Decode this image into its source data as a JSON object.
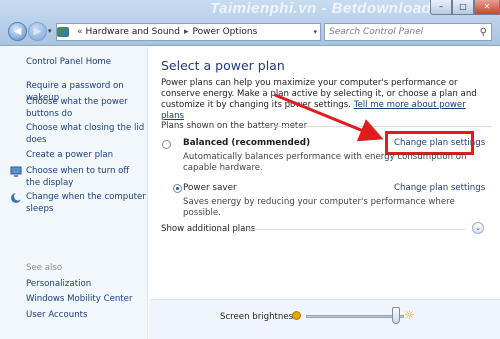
{
  "watermark": "Taimienphi.vn - Betdownload",
  "window": {
    "min": "–",
    "max": "□",
    "close": "✕"
  },
  "nav": {
    "back": "◀",
    "forward": "▶",
    "dropdown": "▾"
  },
  "address": {
    "chevron": "«",
    "crumbs": [
      "Hardware and Sound",
      "Power Options"
    ],
    "separator": "▸",
    "dropdown": "▾"
  },
  "refresh": "↻",
  "search": {
    "placeholder": "Search Control Panel",
    "icon": "⚲"
  },
  "sidebar": {
    "home": "Control Panel Home",
    "items": [
      {
        "label": "Require a password on wakeup"
      },
      {
        "label": "Choose what the power buttons do"
      },
      {
        "label": "Choose what closing the lid does"
      },
      {
        "label": "Create a power plan"
      },
      {
        "label": "Choose when to turn off the display"
      },
      {
        "label": "Change when the computer sleeps"
      }
    ],
    "see_also": "See also",
    "see_also_items": [
      "Personalization",
      "Windows Mobility Center",
      "User Accounts"
    ]
  },
  "main": {
    "title": "Select a power plan",
    "desc": "Power plans can help you maximize your computer's performance or conserve energy. Make a plan active by selecting it, or choose a plan and customize it by changing its power settings.",
    "desc_link": "Tell me more about power plans",
    "section": "Plans shown on the battery meter",
    "plans": [
      {
        "name": "Balanced (recommended)",
        "desc": "Automatically balances performance with energy consumption on capable hardware.",
        "link": "Change plan settings",
        "selected": false
      },
      {
        "name": "Power saver",
        "desc": "Saves energy by reducing your computer's performance where possible.",
        "link": "Change plan settings",
        "selected": true
      }
    ],
    "show_additional": "Show additional plans",
    "expand_icon": "⌄",
    "brightness_label": "Screen brightness:",
    "brightness_value": 0.92,
    "sun_icon": "☼"
  },
  "annotation_color": "#e11c1c"
}
